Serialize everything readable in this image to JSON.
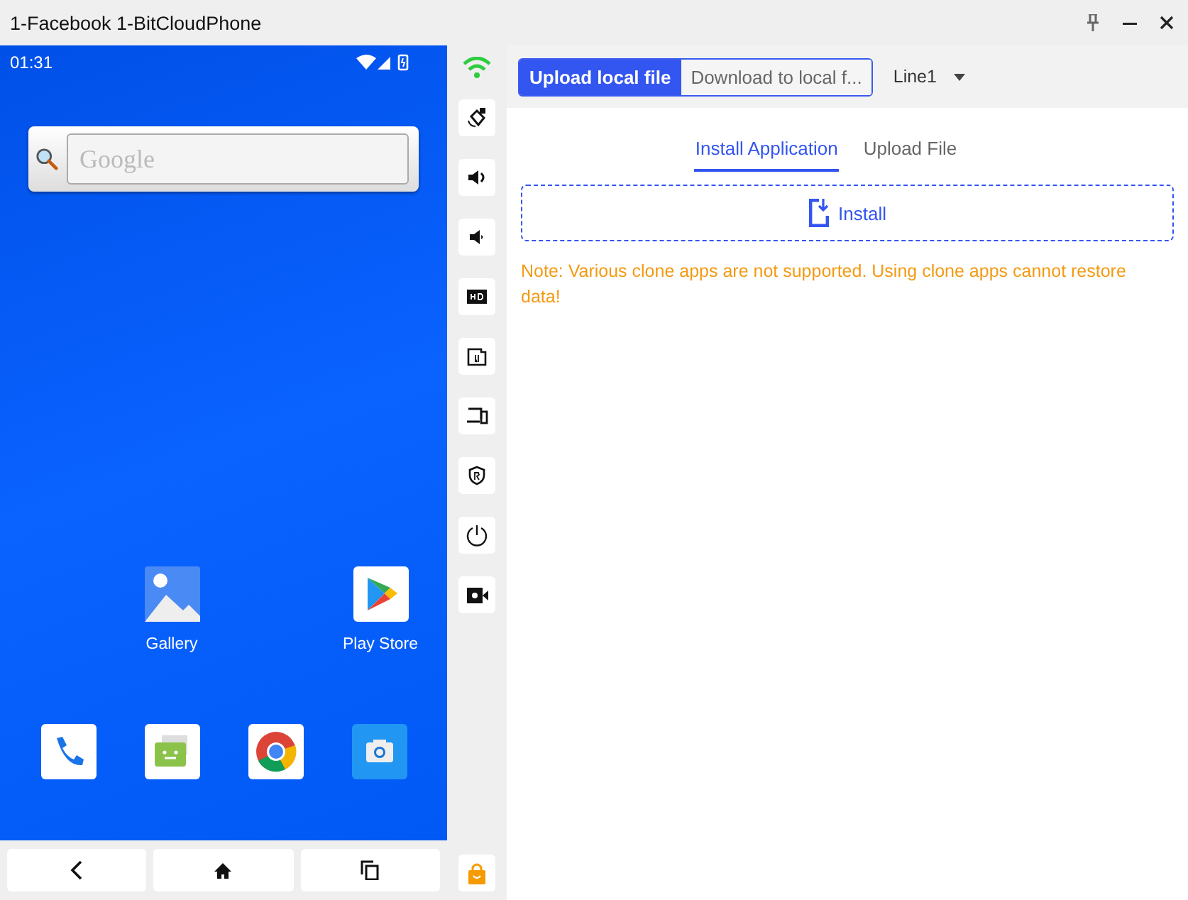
{
  "window": {
    "title": "1-Facebook 1-BitCloudPhone"
  },
  "phone": {
    "time": "01:31",
    "search": {
      "placeholder": "Google"
    },
    "apps": [
      {
        "kind": "gallery",
        "label": "Gallery"
      },
      {
        "kind": "play-store",
        "label": "Play Store"
      }
    ]
  },
  "toolbar": {
    "buttons": [
      {
        "label": "Upload local file",
        "selected": true
      },
      {
        "label": "Download to local f...",
        "selected": false
      }
    ],
    "line_select": "Line1"
  },
  "tabs": [
    {
      "label": "Install Application",
      "selected": true
    },
    {
      "label": "Upload File",
      "selected": false
    }
  ],
  "install_button": "Install",
  "note": "Note: Various clone apps are not supported. Using clone apps cannot restore data!"
}
